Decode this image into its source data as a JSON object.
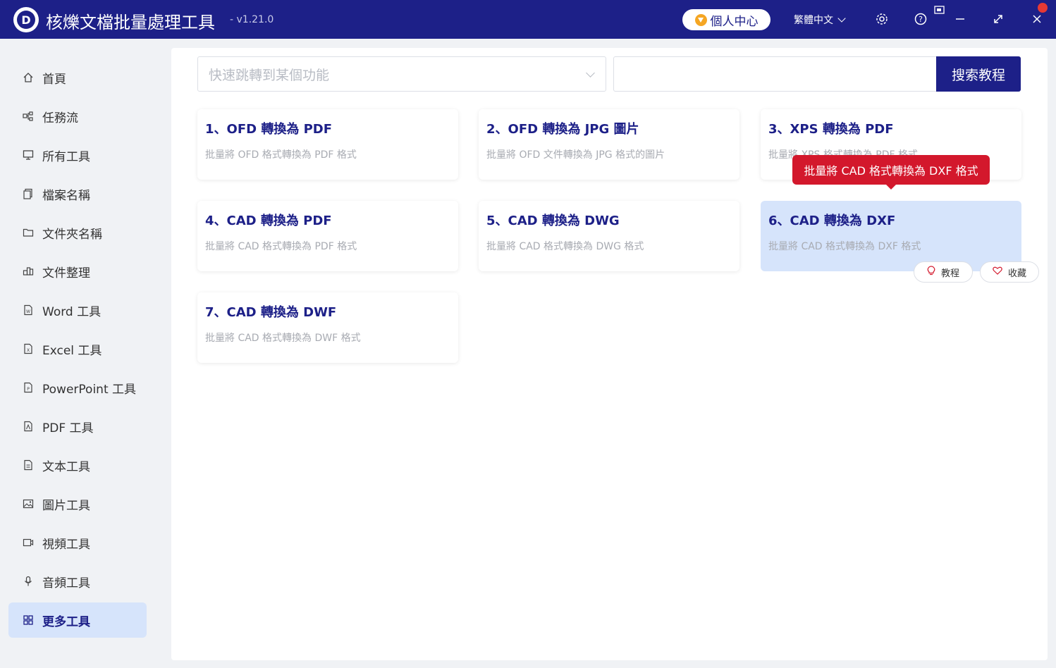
{
  "app": {
    "title": "核爍文檔批量處理工具",
    "version": "- v1.21.0",
    "user_center": "個人中心",
    "language": "繁體中文",
    "colors": {
      "primary": "#1d2088",
      "tooltip": "#d3182c",
      "active_bg": "#d6e4fb"
    }
  },
  "sidebar": {
    "items": [
      {
        "label": "首頁",
        "icon": "home-icon"
      },
      {
        "label": "任務流",
        "icon": "workflow-icon"
      },
      {
        "label": "所有工具",
        "icon": "monitor-icon"
      },
      {
        "label": "檔案名稱",
        "icon": "file-copy-icon"
      },
      {
        "label": "文件夾名稱",
        "icon": "folder-icon"
      },
      {
        "label": "文件整理",
        "icon": "organize-icon"
      },
      {
        "label": "Word 工具",
        "icon": "word-file-icon"
      },
      {
        "label": "Excel 工具",
        "icon": "excel-file-icon"
      },
      {
        "label": "PowerPoint 工具",
        "icon": "ppt-file-icon"
      },
      {
        "label": "PDF 工具",
        "icon": "pdf-file-icon"
      },
      {
        "label": "文本工具",
        "icon": "text-file-icon"
      },
      {
        "label": "圖片工具",
        "icon": "image-icon"
      },
      {
        "label": "視頻工具",
        "icon": "video-icon"
      },
      {
        "label": "音頻工具",
        "icon": "microphone-icon"
      },
      {
        "label": "更多工具",
        "icon": "grid-icon",
        "active": true
      }
    ]
  },
  "toolbar": {
    "jump_placeholder": "快速跳轉到某個功能",
    "search_value": "",
    "search_button": "搜索教程"
  },
  "cards": [
    {
      "title": "1、OFD 轉換為 PDF",
      "desc": "批量將 OFD 格式轉換為 PDF 格式"
    },
    {
      "title": "2、OFD 轉換為 JPG 圖片",
      "desc": "批量將 OFD 文件轉換為 JPG 格式的圖片"
    },
    {
      "title": "3、XPS 轉換為 PDF",
      "desc": "批量將 XPS 格式轉換為 PDF 格式"
    },
    {
      "title": "4、CAD 轉換為 PDF",
      "desc": "批量將 CAD 格式轉換為 PDF 格式"
    },
    {
      "title": "5、CAD 轉換為 DWG",
      "desc": "批量將 CAD 格式轉換為 DWG 格式"
    },
    {
      "title": "6、CAD 轉換為 DXF",
      "desc": "批量將 CAD 格式轉換為 DXF 格式",
      "hovered": true
    },
    {
      "title": "7、CAD 轉換為 DWF",
      "desc": "批量將 CAD 格式轉換為 DWF 格式"
    }
  ],
  "card_actions": {
    "tutorial": "教程",
    "favorite": "收藏"
  },
  "tooltip": {
    "text": "批量將 CAD 格式轉換為 DXF 格式"
  }
}
